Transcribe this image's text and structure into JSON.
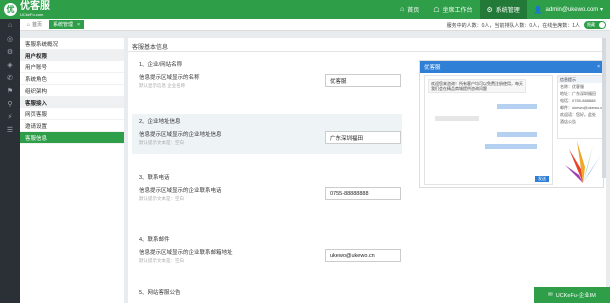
{
  "app": {
    "logo_glyph": "优",
    "logo_text": "优客服",
    "logo_sub": "UCkeFu.com"
  },
  "topnav": [
    {
      "icon": "⌂",
      "label": "首页"
    },
    {
      "icon": "☖",
      "label": "坐席工作台"
    },
    {
      "icon": "⚙",
      "label": "系统管理"
    },
    {
      "icon": "👤",
      "label": "admin@ukewo.com ▾"
    }
  ],
  "tabs": [
    {
      "icon": "⌂",
      "label": "首页"
    },
    {
      "label": "系统管理",
      "close": "×"
    }
  ],
  "status": {
    "text": "服务中的人数：0人，当前排队人数：0人，在线坐席数：1人",
    "toggle": "隐藏"
  },
  "iconbar": [
    "⌂",
    "◎",
    "⚙",
    "◈",
    "✆",
    "⚑",
    "⚲",
    "⚡",
    "☰"
  ],
  "leftnav": {
    "system_overview": "客服系统概况",
    "group_user": "用户权限",
    "user_items": [
      "用户账号",
      "系统角色",
      "组织架构"
    ],
    "group_access": "客服接入",
    "access_items": [
      "网页客服",
      "邀请设置",
      "客服信息"
    ]
  },
  "main": {
    "title": "客服基本信息",
    "sections": [
      {
        "title": "1、企业/网站名称",
        "desc": "信息提示区域显示的名称",
        "hint": "默认显示信息 企业名称",
        "value": "优客服"
      },
      {
        "title": "2、企业地址信息",
        "desc": "信息提示区域显示的企业地址信息",
        "hint": "默认提示文本是：空白",
        "value": "广东深圳福田"
      },
      {
        "title": "3、联系电话",
        "desc": "信息提示区域显示的企业联系电话",
        "hint": "默认提示文本是：空白",
        "value": "0755-88888888"
      },
      {
        "title": "4、联系邮件",
        "desc": "信息提示区域显示的企业联系邮箱地址",
        "hint": "默认提示文本是：空白",
        "value": "ukewo@ukewo.cn"
      },
      {
        "title": "5、网站客服公告",
        "desc": "",
        "hint": "",
        "value": ""
      }
    ]
  },
  "preview": {
    "header": "优客服",
    "close": "×",
    "welcome": "欢迎您来咨询！所有客户均可以免费注册使用，每天我们会在精品商城提供咨询问题",
    "send": "发送",
    "info_title": "信息提示",
    "info_rows": [
      "名称：优客服",
      "地址：广东深圳福田",
      "电话：0755-888888",
      "邮件：ukewo@ukewo.cn",
      "欢迎语：您好。此处",
      "酒店公告"
    ]
  },
  "bottom_badge": {
    "icon": "✉",
    "label": "UCKeFu-企业IM"
  },
  "colors": {
    "brand": "#2e9e49",
    "preview_blue": "#2f7fd7"
  }
}
